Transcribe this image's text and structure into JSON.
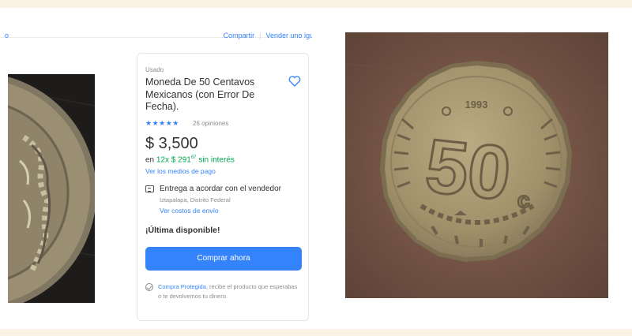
{
  "header": {
    "back_fragment": "o",
    "share_label": "Compartir",
    "sell_label": "Vender uno igual"
  },
  "listing": {
    "condition": "Usado",
    "title": "Moneda De 50 Centavos Mexicanos (con Error De Fecha).",
    "rating_stars": 5,
    "stars_display": "★★★★★",
    "reviews": "26 opiniones",
    "price": "$ 3,500",
    "installments_prefix": "en",
    "installments": "12x $ 291",
    "installments_cents": "67",
    "installments_suffix": "sin interés",
    "payment_link": "Ver los medios de pago",
    "shipping": "Entrega a acordar con el vendedor",
    "location": "Iztapalapa, Distrito Federal",
    "shipping_costs_link": "Ver costos de envío",
    "stock": "¡Última disponible!",
    "buy_button": "Comprar ahora",
    "protect_link": "Compra Protegida",
    "protect_text": ", recibe el producto que esperabas o te devolvemos tu dinero."
  },
  "coin": {
    "year": "1993",
    "denomination": "50",
    "unit": "c"
  },
  "colors": {
    "accent": "#3483fa",
    "green": "#00a650",
    "background": "#fbf4e6",
    "coin_metal": "#a99a70",
    "photo_background": "#7d5b4b"
  }
}
